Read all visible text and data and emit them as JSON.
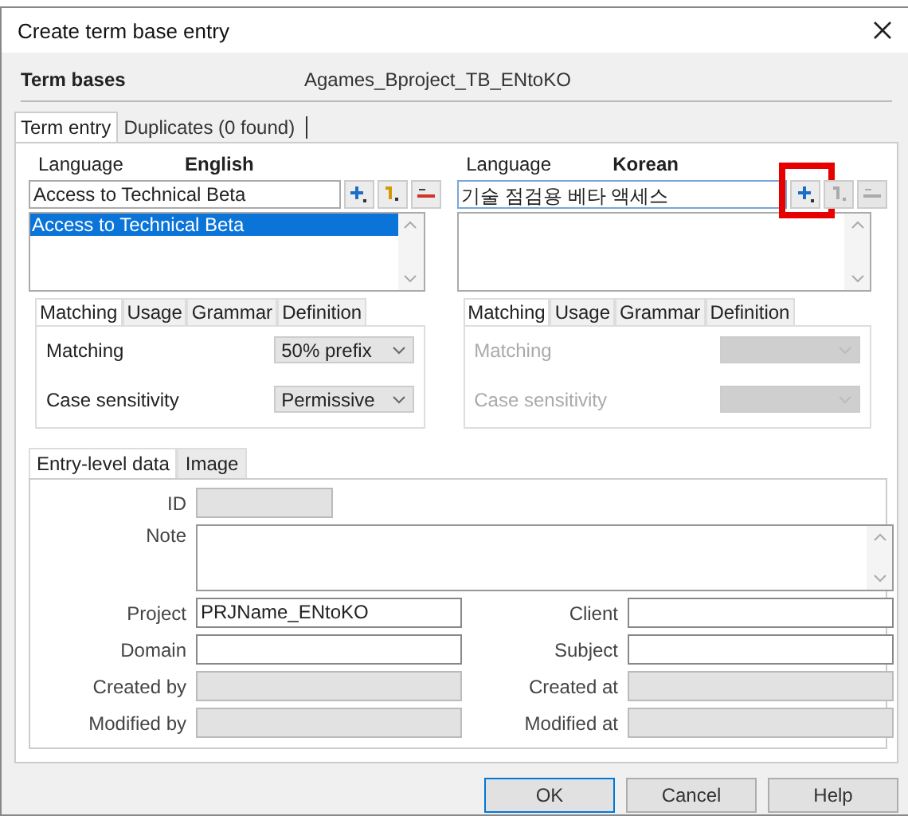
{
  "window": {
    "title": "Create term base entry"
  },
  "term_bases": {
    "label": "Term bases",
    "value": "Agames_Bproject_TB_ENtoKO"
  },
  "tabs": [
    {
      "label": "Term entry",
      "selected": true
    },
    {
      "label": "Duplicates (0 found)",
      "selected": false
    }
  ],
  "languages": [
    {
      "label": "Language",
      "name": "English",
      "term": "Access to Technical Beta",
      "disabled": false,
      "terms": [
        {
          "text": "Access to Technical Beta",
          "selected": true
        }
      ],
      "tool_buttons": [
        {
          "kind": "add",
          "disabled": false,
          "highlighted": false
        },
        {
          "kind": "insert",
          "disabled": false,
          "highlighted": false
        },
        {
          "kind": "remove",
          "disabled": false,
          "highlighted": false
        }
      ],
      "tabs": [
        {
          "label": "Matching",
          "selected": true
        },
        {
          "label": "Usage",
          "selected": false
        },
        {
          "label": "Grammar",
          "selected": false
        },
        {
          "label": "Definition",
          "selected": false
        }
      ],
      "fields": [
        {
          "label": "Matching",
          "value": "50% prefix"
        },
        {
          "label": "Case sensitivity",
          "value": "Permissive"
        }
      ]
    },
    {
      "label": "Language",
      "name": "Korean",
      "term": "기술 점검용 베타 액세스",
      "disabled": true,
      "tool_buttons": [
        {
          "kind": "add",
          "disabled": false,
          "highlighted": true
        },
        {
          "kind": "insert",
          "disabled": true,
          "highlighted": false
        },
        {
          "kind": "remove",
          "disabled": true,
          "highlighted": false
        }
      ],
      "tabs": [
        {
          "label": "Matching",
          "selected": true
        },
        {
          "label": "Usage",
          "selected": false
        },
        {
          "label": "Grammar",
          "selected": false
        },
        {
          "label": "Definition",
          "selected": false
        }
      ],
      "fields": [
        {
          "label": "Matching"
        },
        {
          "label": "Case sensitivity"
        }
      ]
    }
  ],
  "entry_tabs": [
    {
      "label": "Entry-level data",
      "selected": true
    },
    {
      "label": "Image",
      "selected": false
    }
  ],
  "entry": {
    "id": {
      "label": "ID",
      "disabled": true
    },
    "note": {
      "label": "Note"
    },
    "fields": [
      {
        "label": "Project",
        "value": "PRJName_ENtoKO",
        "disabled": false
      },
      {
        "label": "Client",
        "disabled": false
      },
      {
        "label": "Domain",
        "disabled": false
      },
      {
        "label": "Subject",
        "disabled": false
      },
      {
        "label": "Created by",
        "disabled": true
      },
      {
        "label": "Created at",
        "disabled": true
      },
      {
        "label": "Modified by",
        "disabled": true
      },
      {
        "label": "Modified at",
        "disabled": true
      }
    ]
  },
  "buttons": [
    {
      "label": "OK",
      "default": true
    },
    {
      "label": "Cancel",
      "default": false
    },
    {
      "label": "Help",
      "default": false
    }
  ]
}
